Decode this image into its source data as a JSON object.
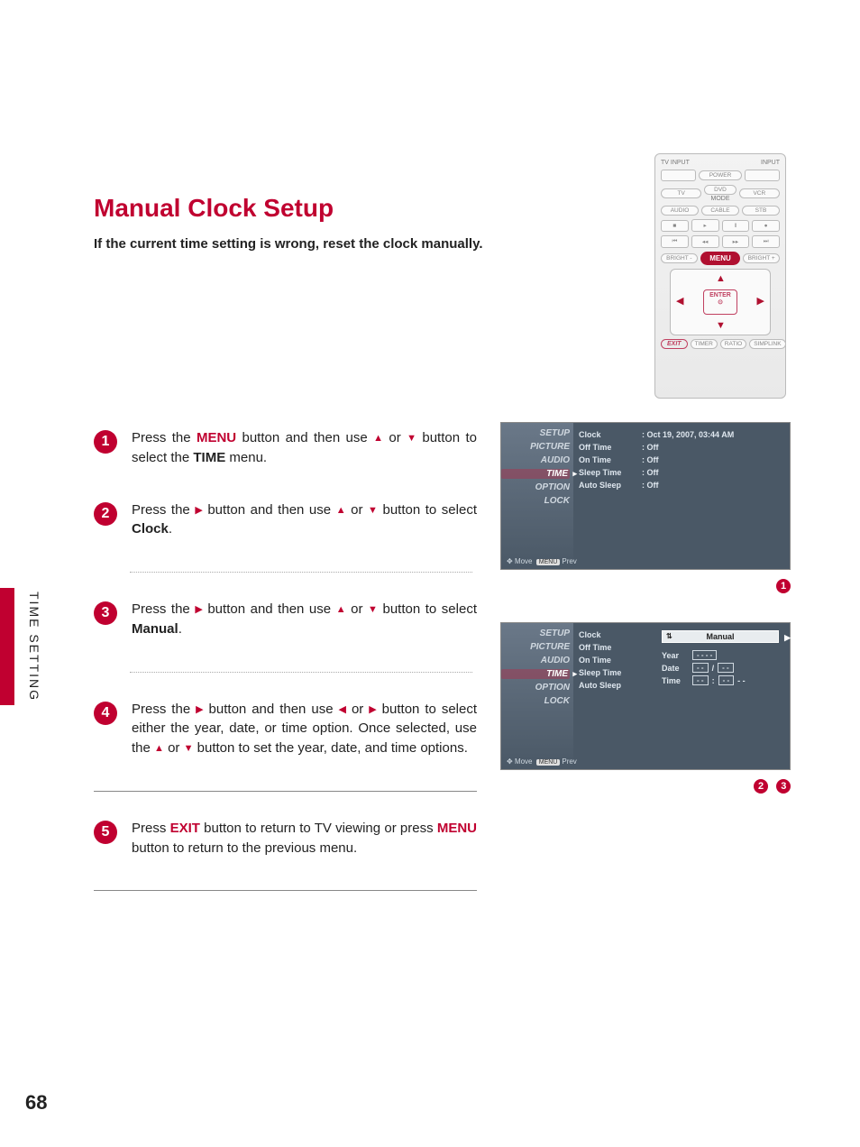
{
  "title": "Manual Clock Setup",
  "subtitle": "If the current time setting is wrong, reset the clock manually.",
  "side_tab": "TIME SETTING",
  "page_num": "68",
  "steps": {
    "s1": {
      "num": "1",
      "pre": "Press the ",
      "hl": "MENU",
      "mid": " button and then use ",
      "post": " button to select the ",
      "bold": "TIME",
      "tail": " menu."
    },
    "s2": {
      "num": "2",
      "pre": "Press the ",
      "mid": " button and then use ",
      "post": " button to select ",
      "bold": "Clock",
      "tail": "."
    },
    "s3": {
      "num": "3",
      "pre": "Press the ",
      "mid": " button and then use ",
      "post": " button to select ",
      "bold": "Manual",
      "tail": "."
    },
    "s4": {
      "num": "4",
      "pre": "Press the ",
      "mid": " button and then use ",
      "post": " button to select either the year, date, or time option. Once selected, use the ",
      "post2": " button to set the year, date, and time options."
    },
    "s5": {
      "num": "5",
      "pre": "Press ",
      "hl": "EXIT",
      "mid": " button to return to TV viewing or press ",
      "hl2": "MENU",
      "tail": " button to return to the previous menu."
    }
  },
  "remote": {
    "tv_input": "TV INPUT",
    "input": "INPUT",
    "power": "POWER",
    "tv": "TV",
    "dvd": "DVD",
    "vcr": "VCR",
    "mode": "MODE",
    "audio": "AUDIO",
    "cable": "CABLE",
    "stb": "STB",
    "bright_minus": "BRIGHT -",
    "menu": "MENU",
    "bright_plus": "BRIGHT +",
    "enter": "ENTER",
    "enter_sym": "⊙",
    "exit": "EXIT",
    "timer": "TIMER",
    "ratio": "RATIO",
    "simplink": "SIMPLINK"
  },
  "osd_menu": {
    "setup": "SETUP",
    "picture": "PICTURE",
    "audio": "AUDIO",
    "time": "TIME",
    "option": "OPTION",
    "lock": "LOCK",
    "move": "Move",
    "prev": "Prev",
    "menu_key": "MENU"
  },
  "osd1": {
    "rows": [
      {
        "label": "Clock",
        "value": ": Oct 19, 2007, 03:44 AM"
      },
      {
        "label": "Off Time",
        "value": ": Off"
      },
      {
        "label": "On Time",
        "value": ": Off"
      },
      {
        "label": "Sleep Time",
        "value": ": Off"
      },
      {
        "label": "Auto Sleep",
        "value": ": Off"
      }
    ]
  },
  "osd2": {
    "rows": [
      "Clock",
      "Off Time",
      "On Time",
      "Sleep Time",
      "Auto Sleep"
    ],
    "manual_label": "Manual",
    "year_label": "Year",
    "year_val": "- - - -",
    "date_label": "Date",
    "date_v1": "- -",
    "date_sep": "/",
    "date_v2": "- -",
    "time_label": "Time",
    "time_v1": "- -",
    "time_sep": ":",
    "time_v2": "- -",
    "time_v3": "- -"
  },
  "ref_nums": {
    "r1": "1",
    "r2": "2",
    "r3": "3"
  }
}
